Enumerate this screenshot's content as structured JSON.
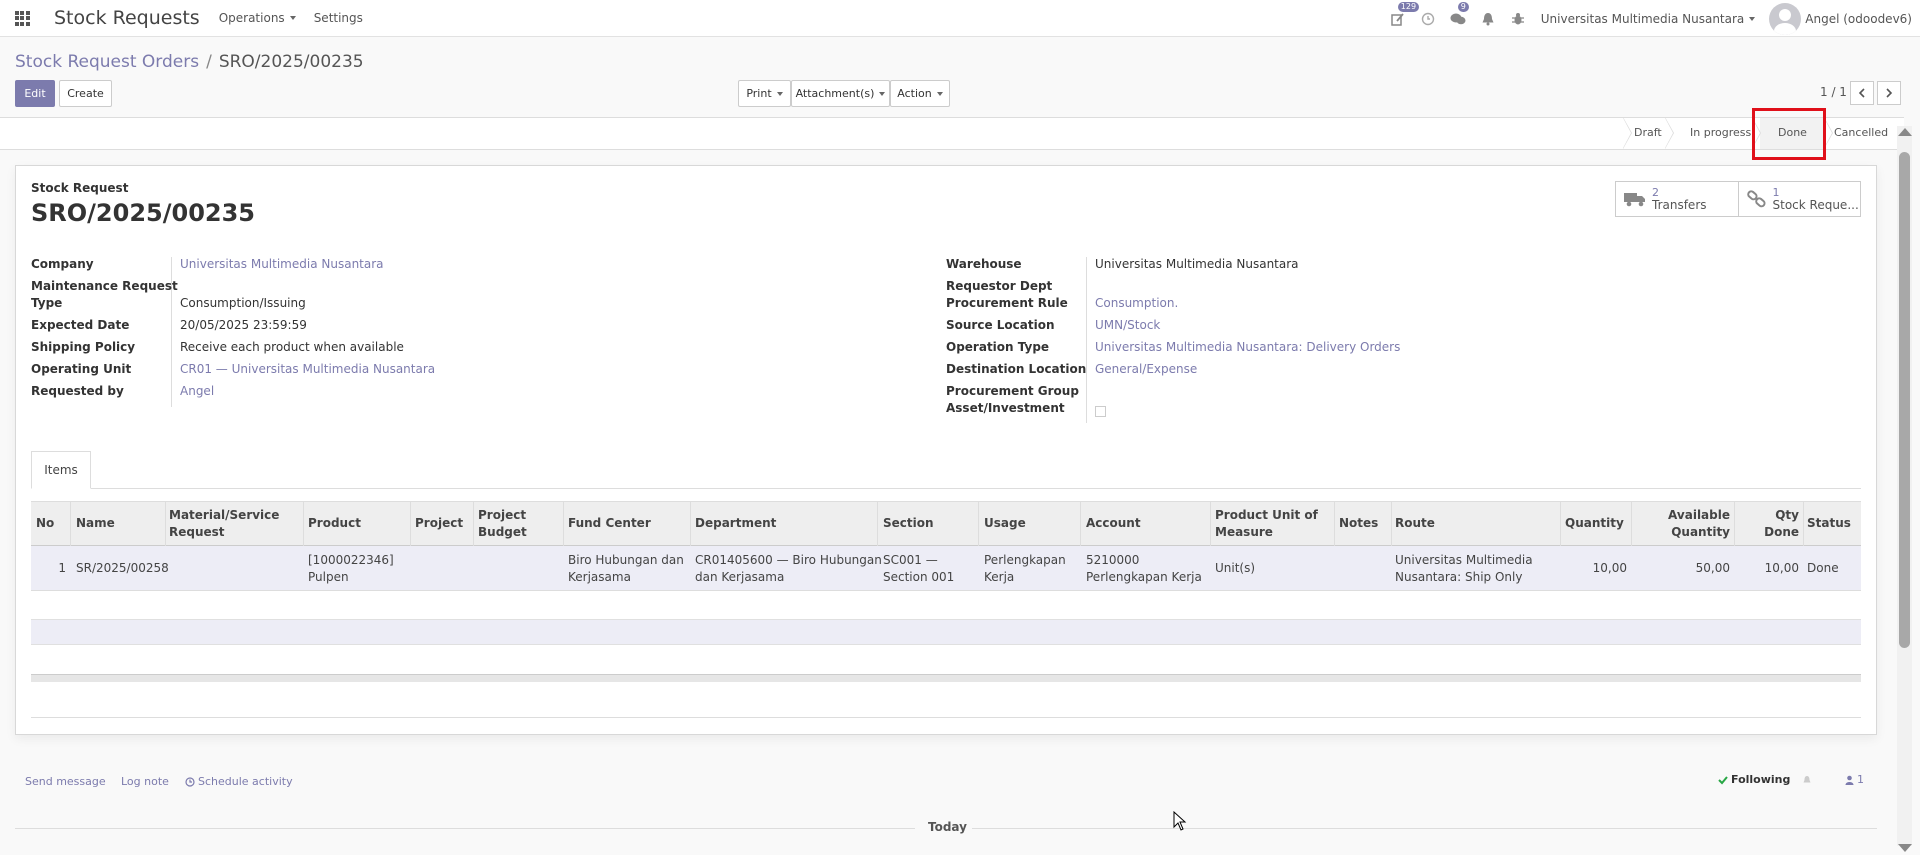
{
  "navbar": {
    "brand": "Stock Requests",
    "menus": [
      {
        "label": "Operations",
        "has_dropdown": true
      },
      {
        "label": "Settings",
        "has_dropdown": false
      }
    ],
    "activity_badge": "129",
    "messages_badge": "9",
    "company": "Universitas Multimedia Nusantara",
    "user": "Angel (odoodev6)"
  },
  "control_panel": {
    "breadcrumb_parent": "Stock Request Orders",
    "breadcrumb_current": "SRO/2025/00235",
    "edit_label": "Edit",
    "create_label": "Create",
    "print_label": "Print",
    "attachments_label": "Attachment(s)",
    "action_label": "Action",
    "pager": "1 / 1"
  },
  "statusbar": {
    "stages": [
      "Draft",
      "In progress",
      "Done",
      "Cancelled"
    ],
    "current": "Done"
  },
  "smart_buttons": [
    {
      "value": "2",
      "label": "Transfers",
      "icon": "truck-icon"
    },
    {
      "value": "1",
      "label": "Stock Reque...",
      "icon": "link-icon"
    }
  ],
  "form": {
    "record_type": "Stock Request",
    "name": "SRO/2025/00235",
    "left": {
      "company_label": "Company",
      "company": "Universitas Multimedia Nusantara",
      "maintenance_label_1": "Maintenance Request",
      "maintenance_label_2": "Type",
      "type": "Consumption/Issuing",
      "expected_date_label": "Expected Date",
      "expected_date": "20/05/2025 23:59:59",
      "shipping_policy_label": "Shipping Policy",
      "shipping_policy": "Receive each product when available",
      "operating_unit_label": "Operating Unit",
      "operating_unit": "CR01 — Universitas Multimedia Nusantara",
      "requested_by_label": "Requested by",
      "requested_by": "Angel"
    },
    "right": {
      "warehouse_label": "Warehouse",
      "warehouse": "Universitas Multimedia Nusantara",
      "requestor_dept_label": "Requestor Dept",
      "procurement_rule_label": "Procurement Rule",
      "procurement_rule": "Consumption.",
      "source_location_label": "Source Location",
      "source_location": "UMN/Stock",
      "operation_type_label": "Operation Type",
      "operation_type": "Universitas Multimedia Nusantara: Delivery Orders",
      "destination_location_label": "Destination Location",
      "destination_location": "General/Expense",
      "procurement_group_label": "Procurement Group",
      "asset_investment_label": "Asset/Investment",
      "asset_investment": false
    }
  },
  "tabs": [
    {
      "label": "Items"
    }
  ],
  "table": {
    "headers": {
      "no": "No",
      "name": "Name",
      "material_1": "Material/Service",
      "material_2": "Request",
      "product": "Product",
      "project": "Project",
      "project_budget_1": "Project",
      "project_budget_2": "Budget",
      "fund_center": "Fund Center",
      "department": "Department",
      "section": "Section",
      "usage": "Usage",
      "account": "Account",
      "uom_1": "Product Unit of",
      "uom_2": "Measure",
      "notes": "Notes",
      "route": "Route",
      "quantity": "Quantity",
      "available_1": "Available",
      "available_2": "Quantity",
      "qty_done_1": "Qty",
      "qty_done_2": "Done",
      "status": "Status"
    },
    "rows": [
      {
        "no": "1",
        "name": "SR/2025/00258",
        "material": "",
        "product_1": "[1000022346]",
        "product_2": "Pulpen",
        "project": "",
        "project_budget": "",
        "fund_center_1": "Biro Hubungan dan",
        "fund_center_2": "Kerjasama",
        "department_1": "CR01405600 — Biro Hubungan",
        "department_2": "dan Kerjasama",
        "section_1": "SC001 —",
        "section_2": "Section 001",
        "usage_1": "Perlengkapan",
        "usage_2": "Kerja",
        "account_1": "5210000",
        "account_2": "Perlengkapan Kerja",
        "uom": "Unit(s)",
        "notes": "",
        "route_1": "Universitas Multimedia",
        "route_2": "Nusantara: Ship Only",
        "quantity": "10,00",
        "available": "50,00",
        "qty_done": "10,00",
        "status": "Done"
      }
    ]
  },
  "chatter": {
    "send_message": "Send message",
    "log_note": "Log note",
    "schedule_activity": "Schedule activity",
    "following": "Following",
    "followers": "1",
    "today": "Today"
  }
}
